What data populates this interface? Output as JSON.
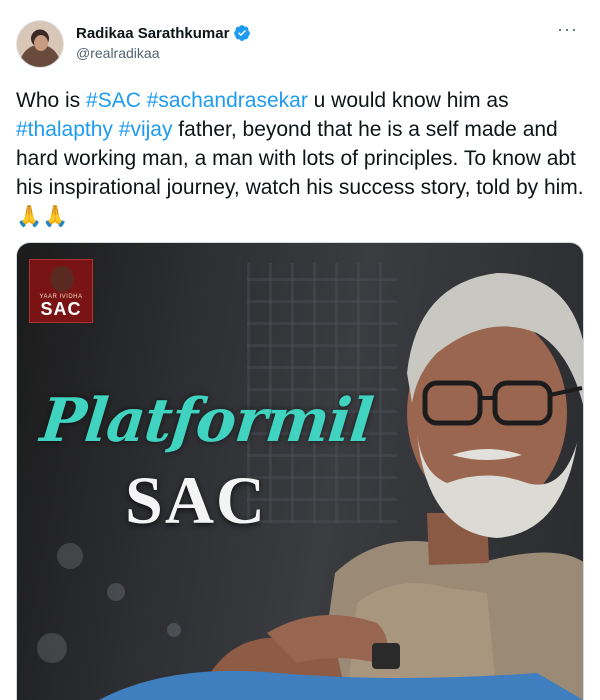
{
  "tweet": {
    "author_name": "Radikaa Sarathkumar",
    "author_handle": "@realradikaa",
    "more_menu": "···",
    "text_parts": [
      "Who is ",
      "#SAC",
      " ",
      "#sachandrasekar",
      " u would know him as ",
      "#thalapthy",
      " ",
      "#vijay",
      "  father, beyond that he is a self made and hard working man, a man with lots of principles. To know abt his inspirational journey, watch his success story, told by him.",
      "🙏🙏"
    ]
  },
  "media": {
    "logo_small": "YAAR IVIDHA",
    "logo_big": "SAC",
    "title_script": "Platformil",
    "title_main": "SAC"
  },
  "colors": {
    "link": "#1d9bf0",
    "verified": "#1d9bf0",
    "title_teal": "#3fd3c0",
    "logo_red": "#7a1414"
  },
  "icons": {
    "verified": "verified-badge-icon",
    "more": "more-options-icon"
  }
}
